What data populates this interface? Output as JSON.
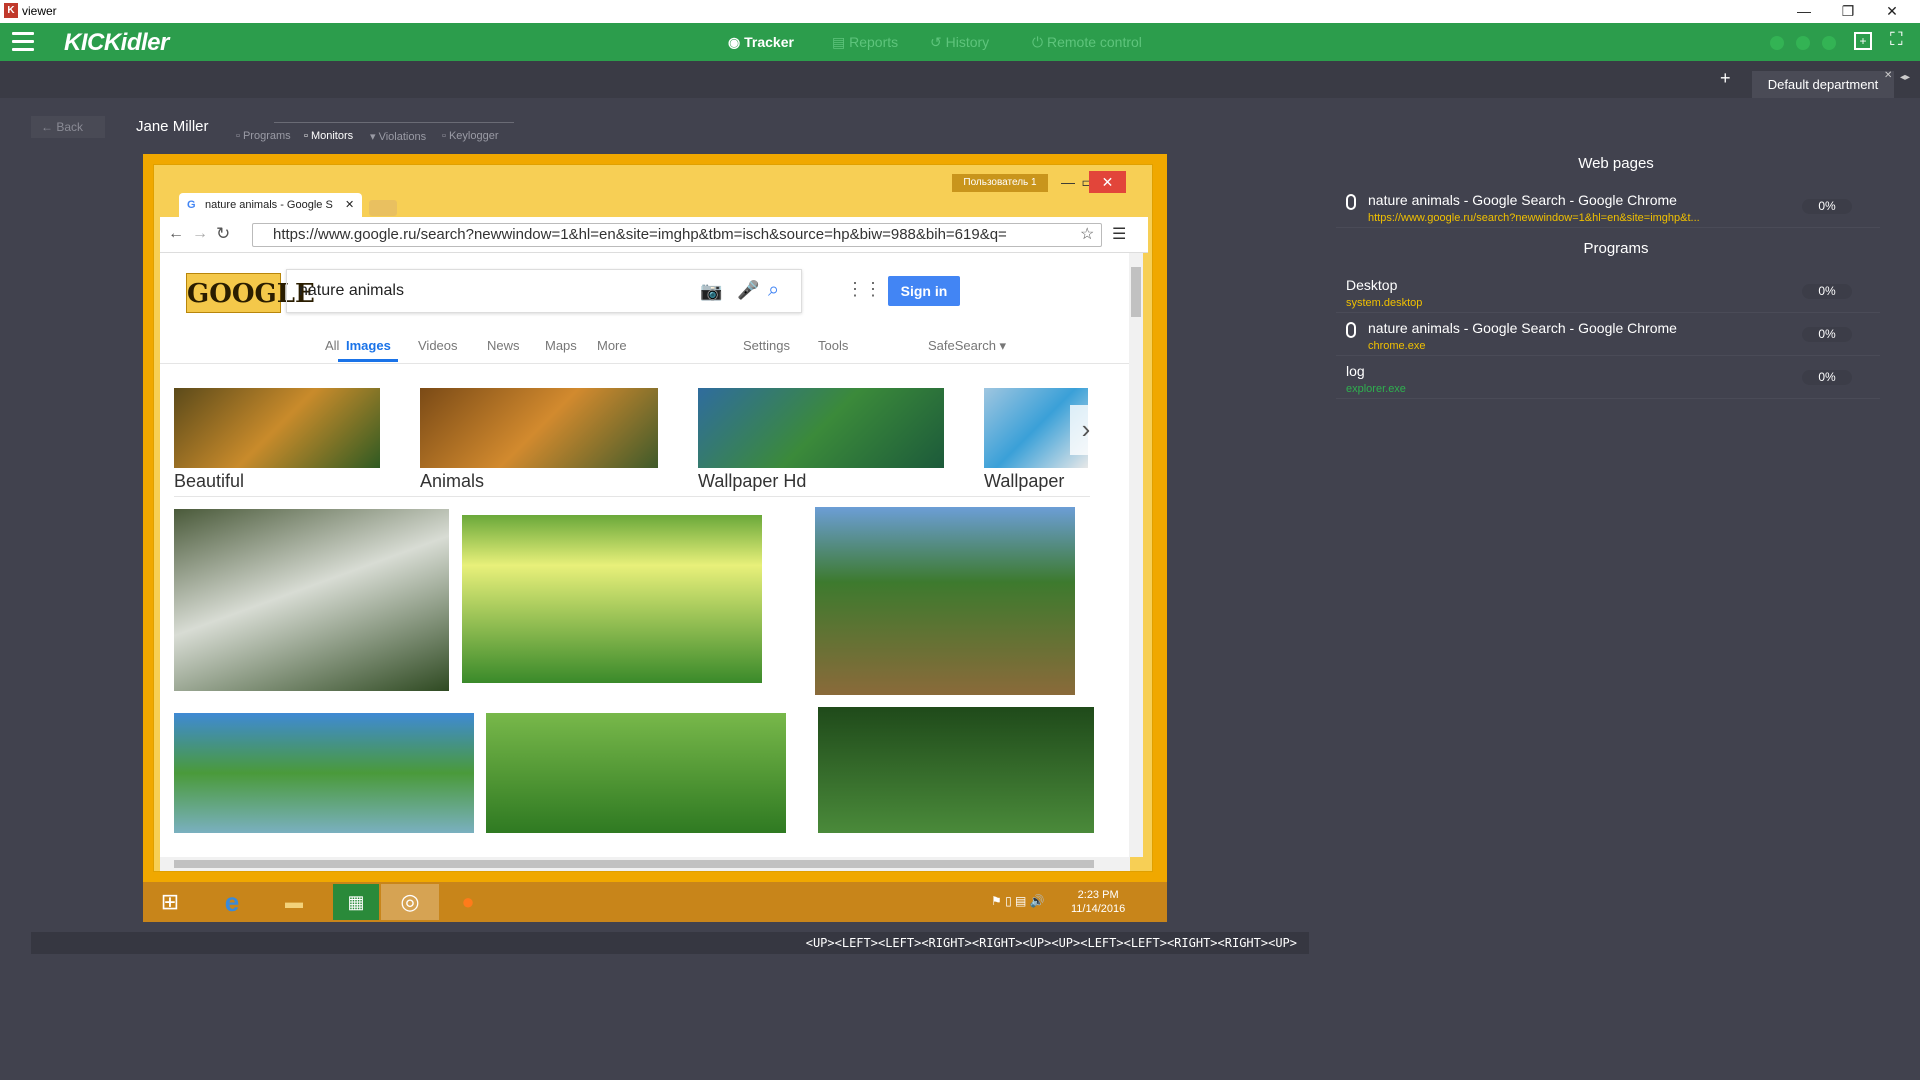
{
  "window": {
    "title": "viewer",
    "logo_letter": "K"
  },
  "header": {
    "brand": "KICKidler",
    "nav": [
      {
        "label": "Tracker",
        "active": true
      },
      {
        "label": "Reports",
        "active": false
      },
      {
        "label": "History",
        "active": false
      },
      {
        "label": "Remote control",
        "active": false
      }
    ]
  },
  "department": {
    "tab_label": "Default department",
    "add": "+"
  },
  "subheader": {
    "back": "← Back",
    "user": "Jane Miller",
    "tabs": [
      "Programs",
      "Monitors",
      "Violations",
      "Keylogger"
    ],
    "active_tab": "Monitors"
  },
  "screenshot": {
    "user_badge": "Пользователь 1",
    "tab_title": "nature animals - Google S",
    "url": "https://www.google.ru/search?newwindow=1&hl=en&site=imghp&tbm=isch&source=hp&biw=988&bih=619&q=",
    "logo_text": "GOOGLE",
    "search_query": "nature animals",
    "sign_in": "Sign in",
    "tabs": [
      "All",
      "Images",
      "Videos",
      "News",
      "Maps",
      "More",
      "Settings",
      "Tools"
    ],
    "active_tab": "Images",
    "safesearch": "SafeSearch ▾",
    "categories": [
      "Beautiful",
      "Animals",
      "Wallpaper Hd",
      "Wallpaper"
    ],
    "clock_time": "2:23 PM",
    "clock_date": "11/14/2016"
  },
  "keylog": "<UP><LEFT><LEFT><RIGHT><RIGHT><UP><UP><LEFT><LEFT><RIGHT><RIGHT><UP>",
  "right_panel": {
    "web_title": "Web pages",
    "web_pages": [
      {
        "name": "nature animals - Google Search - Google Chrome",
        "url": "https://www.google.ru/search?newwindow=1&hl=en&site=imghp&t...",
        "pct": "0%"
      }
    ],
    "programs_title": "Programs",
    "programs": [
      {
        "name": "Desktop",
        "exe": "system.desktop",
        "pct": "0%"
      },
      {
        "name": "nature animals - Google Search - Google Chrome",
        "exe": "chrome.exe",
        "pct": "0%"
      },
      {
        "name": "log",
        "exe": "explorer.exe",
        "pct": "0%"
      }
    ]
  },
  "colors": {
    "accent": "#2c9d4c",
    "link": "#f0c000",
    "exe_green": "#2fb04f"
  }
}
